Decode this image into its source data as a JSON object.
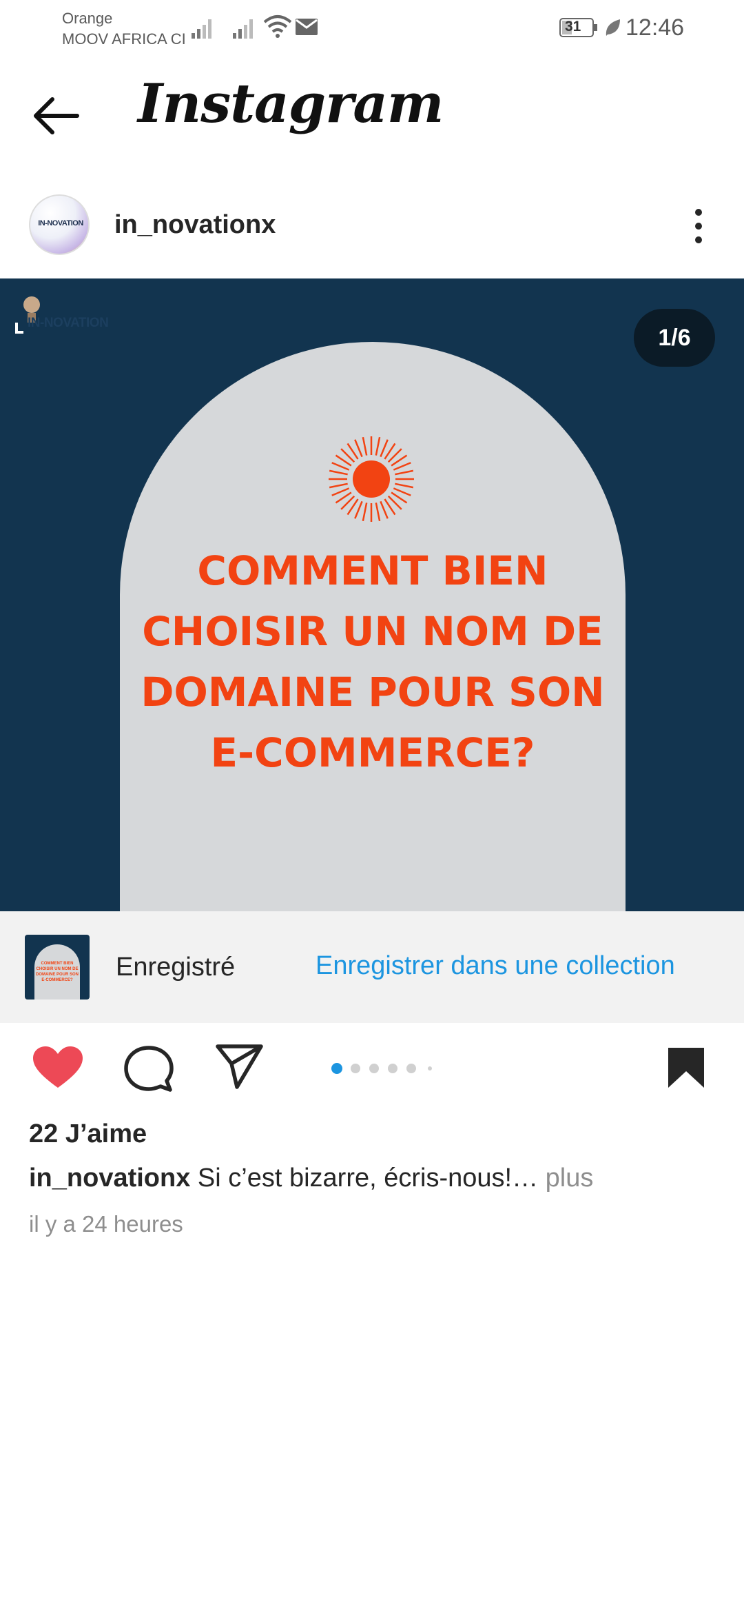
{
  "status_bar": {
    "carrier_1": "Orange",
    "carrier_2": "MOOV AFRICA CI",
    "battery": "31",
    "time": "12:46"
  },
  "header": {
    "app_title": "Instagram",
    "back_icon": "arrow-left-icon"
  },
  "post": {
    "username": "in_novationx",
    "avatar_text": "IN-NOVATION",
    "more_icon": "vertical-dots-icon",
    "image": {
      "logo_text": "IN-NOVATION",
      "counter": "1/6",
      "headline": [
        "COMMENT BIEN",
        "CHOISIR UN NOM DE",
        "DOMAINE POUR SON",
        "E-COMMERCE?"
      ],
      "colors": {
        "background": "#12344f",
        "arch": "#d6d8da",
        "accent": "#f24312"
      }
    },
    "saved_banner": {
      "thumb_text": "COMMENT BIEN CHOISIR UN NOM DE DOMAINE POUR SON E-COMMERCE?",
      "label": "Enregistré",
      "action": "Enregistrer dans une collection"
    },
    "actions": {
      "like_icon": "heart-filled-icon",
      "comment_icon": "comment-bubble-icon",
      "share_icon": "paper-plane-icon",
      "save_icon": "bookmark-filled-icon",
      "carousel_dots": 6,
      "carousel_active": 1
    },
    "likes": "22 J’aime",
    "caption": {
      "user": "in_novationx",
      "text": " Si c’est bizarre, écris-nous!…",
      "more": " plus"
    },
    "timestamp": "il y a 24 heures"
  },
  "colors": {
    "link": "#1c95e0",
    "like": "#ed4956",
    "text": "#262626",
    "muted": "#8e8e8e"
  }
}
